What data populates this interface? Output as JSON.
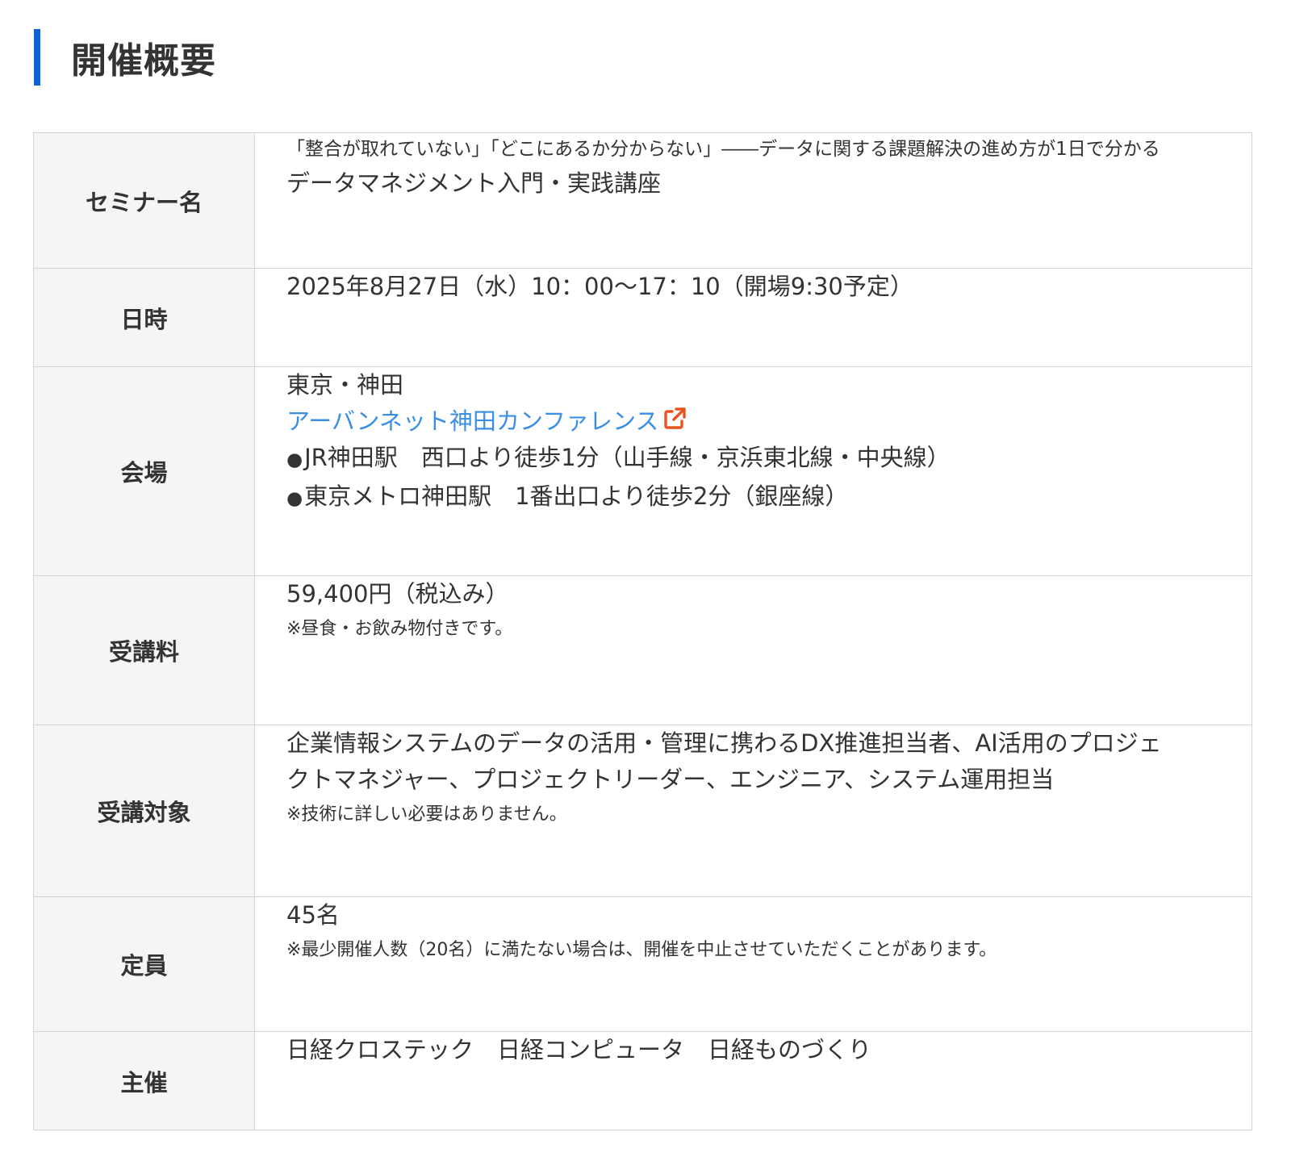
{
  "heading": {
    "title": "開催概要",
    "accent_color": "#0b63d1"
  },
  "rows": {
    "seminar": {
      "label": "セミナー名",
      "subtitle": "「整合が取れていない」「どこにあるか分からない」――データに関する課題解決の進め方が1日で分かる",
      "title": "データマネジメント入門・実践講座"
    },
    "datetime": {
      "label": "日時",
      "value": "2025年8月27日（水）10：00～17：10（開場9:30予定）"
    },
    "venue": {
      "label": "会場",
      "area": "東京・神田",
      "link_text": "アーバンネット神田カンファレンス",
      "link_icon": "external-link-icon",
      "link_color": "#3a8ee6",
      "icon_color": "#e8541e",
      "access": [
        {
          "bullet": "●",
          "text": "JR神田駅　西口より徒歩1分（山手線・京浜東北線・中央線）"
        },
        {
          "bullet": "●",
          "text": "東京メトロ神田駅　1番出口より徒歩2分（銀座線）"
        }
      ]
    },
    "fee": {
      "label": "受講料",
      "value": "59,400円（税込み）",
      "note": "※昼食・お飲み物付きです。"
    },
    "audience": {
      "label": "受講対象",
      "line1": "企業情報システムのデータの活用・管理に携わるDX推進担当者、AI活用のプロジェ",
      "line2": "クトマネジャー、プロジェクトリーダー、エンジニア、システム運用担当",
      "note": "※技術に詳しい必要はありません。"
    },
    "capacity": {
      "label": "定員",
      "value": "45名",
      "note": "※最少開催人数（20名）に満たない場合は、開催を中止させていただくことがあります。"
    },
    "organizer": {
      "label": "主催",
      "value": "日経クロステック　日経コンピュータ　日経ものづくり"
    }
  }
}
